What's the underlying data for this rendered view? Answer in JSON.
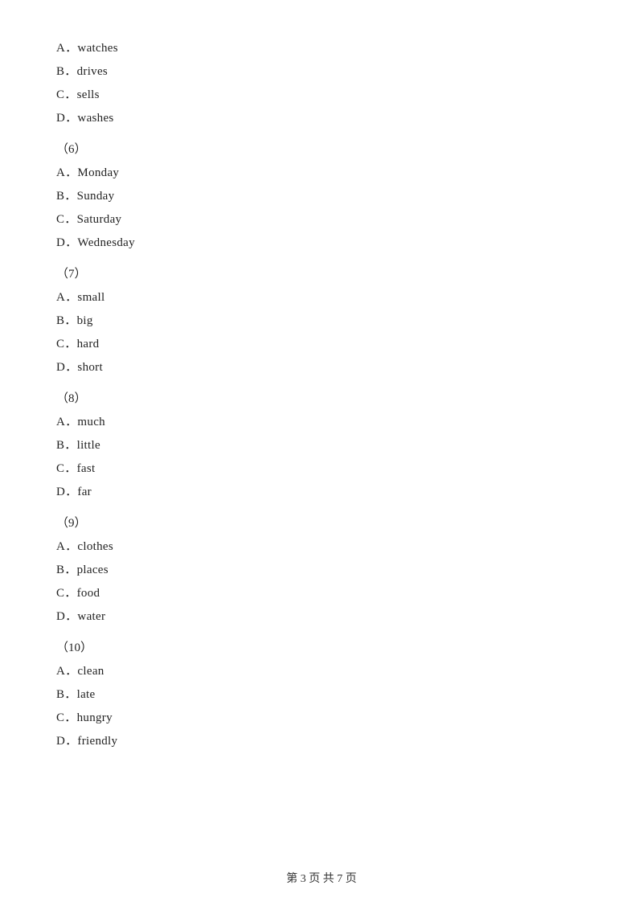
{
  "questions": [
    {
      "id": "q5_options",
      "number": null,
      "options": [
        {
          "label": "A．watches"
        },
        {
          "label": "B．drives"
        },
        {
          "label": "C．sells"
        },
        {
          "label": "D．washes"
        }
      ]
    },
    {
      "id": "q6",
      "number": "（6）",
      "options": [
        {
          "label": "A．Monday"
        },
        {
          "label": "B．Sunday"
        },
        {
          "label": "C．Saturday"
        },
        {
          "label": "D．Wednesday"
        }
      ]
    },
    {
      "id": "q7",
      "number": "（7）",
      "options": [
        {
          "label": "A．small"
        },
        {
          "label": "B．big"
        },
        {
          "label": "C．hard"
        },
        {
          "label": "D．short"
        }
      ]
    },
    {
      "id": "q8",
      "number": "（8）",
      "options": [
        {
          "label": "A．much"
        },
        {
          "label": "B．little"
        },
        {
          "label": "C．fast"
        },
        {
          "label": "D．far"
        }
      ]
    },
    {
      "id": "q9",
      "number": "（9）",
      "options": [
        {
          "label": "A．clothes"
        },
        {
          "label": "B．places"
        },
        {
          "label": "C．food"
        },
        {
          "label": "D．water"
        }
      ]
    },
    {
      "id": "q10",
      "number": "（10）",
      "options": [
        {
          "label": "A．clean"
        },
        {
          "label": "B．late"
        },
        {
          "label": "C．hungry"
        },
        {
          "label": "D．friendly"
        }
      ]
    }
  ],
  "footer": {
    "text": "第 3 页 共 7 页"
  }
}
